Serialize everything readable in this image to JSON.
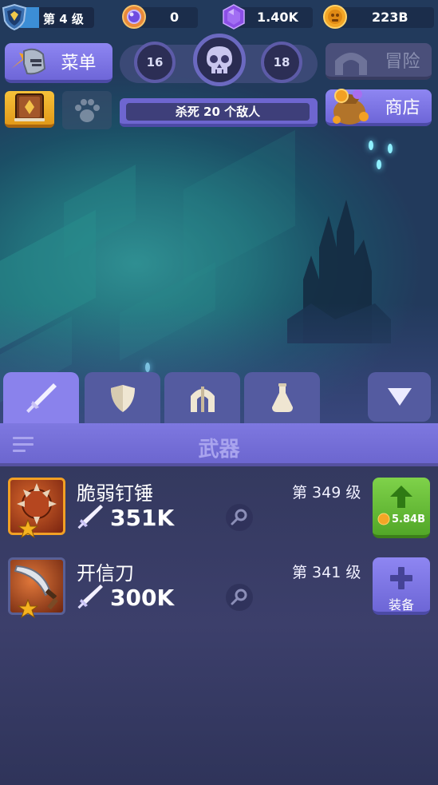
{
  "hud": {
    "level_label": "第 4 级",
    "orb_count": "0",
    "gem_count": "1.40K",
    "coin_count": "223B"
  },
  "menu_button": {
    "label": "菜单"
  },
  "adventure_button": {
    "label": "冒险",
    "enabled": false
  },
  "shop_button": {
    "label": "商店"
  },
  "stage": {
    "previous": "16",
    "next": "18",
    "quest": "杀死 20 个敌人"
  },
  "tabs": [
    {
      "icon": "sword-icon",
      "active": true
    },
    {
      "icon": "shield-icon",
      "active": false
    },
    {
      "icon": "helmet-icon",
      "active": false
    },
    {
      "icon": "potion-icon",
      "active": false
    },
    {
      "icon": "dropdown-arrow-icon",
      "active": false
    }
  ],
  "section": {
    "title": "武器"
  },
  "items": [
    {
      "name": "脆弱钉锤",
      "power": "351K",
      "level": "第 349 级",
      "action": "upgrade",
      "cost": "5.84B",
      "icon": "spiked-mace-icon",
      "stars": 1
    },
    {
      "name": "开信刀",
      "power": "300K",
      "level": "第 341 级",
      "action": "equip",
      "action_label": "装备",
      "icon": "curved-blade-icon",
      "stars": 1
    }
  ],
  "colors": {
    "accent_purple": "#8a82ec",
    "upgrade_green": "#6cc43b",
    "coin_gold": "#f3a626",
    "gem_purple": "#8b4fe6"
  }
}
